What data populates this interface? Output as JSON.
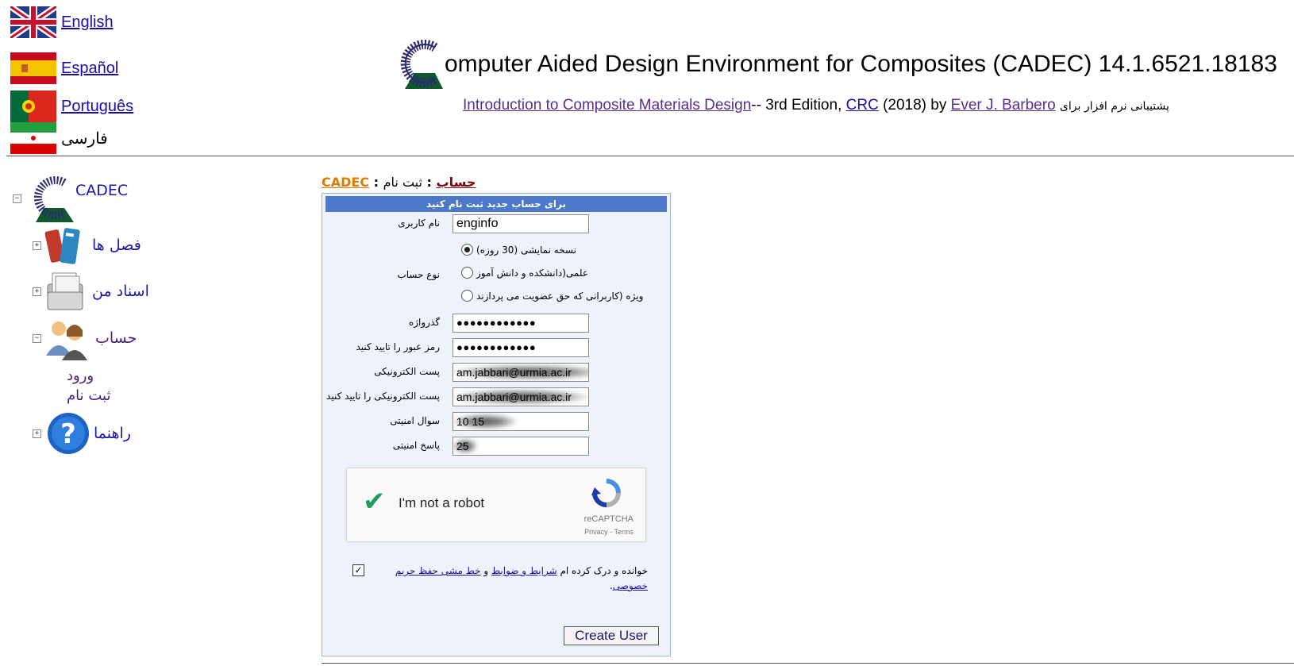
{
  "languages": [
    {
      "label": "English",
      "flag": "uk-flag-icon",
      "link": true
    },
    {
      "label": "Español",
      "flag": "spain-flag-icon",
      "link": true
    },
    {
      "label": "Português",
      "flag": "portugal-flag-icon",
      "link": true
    },
    {
      "label": "فارسی",
      "flag": "iran-flag-icon",
      "link": false
    }
  ],
  "header": {
    "title": "omputer Aided Design Environment for Composites (CADEC) 14.1.6521.18183",
    "book_link": "Introduction to Composite Materials Design",
    "edition": "-- 3rd Edition,",
    "publisher_link": "CRC",
    "year_by": "(2018) by",
    "author_link": "Ever J. Barbero",
    "support_text": "پشتیبانی نرم افزار برای"
  },
  "tree": {
    "root": "CADEC",
    "items": [
      {
        "label": "فصل ها",
        "icon": "books-icon",
        "toggle": "+"
      },
      {
        "label": "اسناد من",
        "icon": "documents-icon",
        "toggle": "+"
      },
      {
        "label": "حساب",
        "icon": "users-icon",
        "toggle": "−"
      },
      {
        "label": "راهنما",
        "icon": "help-icon",
        "toggle": "+"
      }
    ],
    "account_children": [
      "ورود",
      "ثبت نام"
    ]
  },
  "breadcrumb": {
    "root": "CADEC",
    "sep": ":",
    "account": "حساب",
    "current": "ثبت نام"
  },
  "form": {
    "heading": "برای حساب جدید ثبت نام کنید",
    "username_label": "نام کاربری",
    "username_value": "enginfo",
    "account_type_label": "نوع حساب",
    "account_types": [
      "نسخه نمایشی (30 روزه)",
      "علمی(دانشکده و دانش آموز",
      "ویژه (کاربرانی که حق عضویت می پردازند"
    ],
    "password_label": "گذرواژه",
    "password_value": "●●●●●●●●●●●●",
    "confirm_password_label": "رمز عبور را تایید کنید",
    "confirm_password_value": "●●●●●●●●●●●●",
    "email_label": "پست الکترونیکی",
    "email_value": "am.jabbari@urmia.ac.ir",
    "confirm_email_label": "پست الکترونیکی را تایید کنید",
    "confirm_email_value": "am.jabbari@urmia.ac.ir",
    "security_question_label": "سوال امنیتی",
    "security_question_value": "10 15",
    "security_answer_label": "پاسخ امنیتی",
    "security_answer_value": "25",
    "captcha_text": "I'm not a robot",
    "captcha_brand": "reCAPTCHA",
    "captcha_links": "Privacy - Terms",
    "terms_prefix": "خوانده و درک کرده ام",
    "terms_link": "شرایط و ضوابط",
    "terms_and": "و",
    "privacy_link": "خط مشی حفظ حریم خصوصی",
    "terms_end": ".",
    "submit": "Create User"
  },
  "colors": {
    "panel_head": "#4b79c8",
    "panel_bg": "#eef3fb",
    "link": "#1a0dab",
    "crumb_root": "#e07a00"
  }
}
